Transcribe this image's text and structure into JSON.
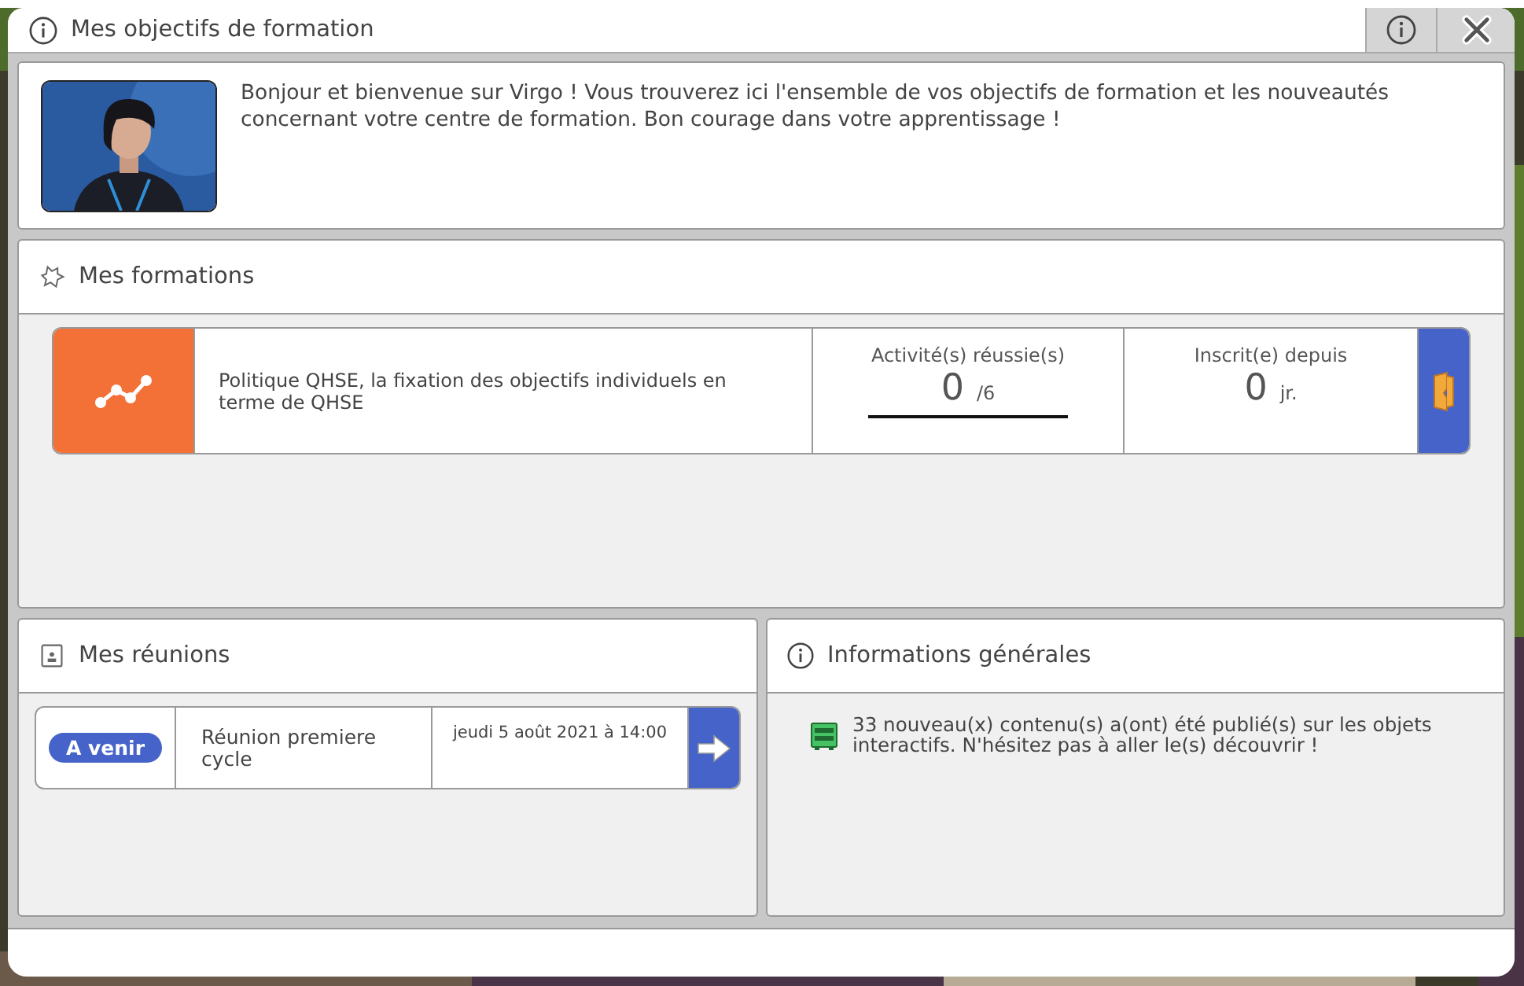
{
  "window": {
    "title": "Mes objectifs de formation"
  },
  "welcome": {
    "kind": "picture",
    "text": "Bonjour et bienvenue sur Virgo ! Vous trouverez ici l'ensemble de vos objectifs de formation et les nouveautés concernant votre centre de formation. Bon courage dans votre apprentissage !"
  },
  "formations": {
    "title": "Mes formations",
    "items": [
      {
        "name": "Politique QHSE, la fixation des objectifs individuels en terme de QHSE",
        "activities_label": "Activité(s) réussie(s)",
        "activities_done": "0",
        "activities_total": "/6",
        "since_label": "Inscrit(e) depuis",
        "since_value": "0",
        "since_unit": "jr."
      }
    ]
  },
  "meetings": {
    "title": "Mes réunions",
    "items": [
      {
        "status": "A venir",
        "title": "Réunion premiere cycle",
        "date": "jeudi 5 août 2021 à 14:00"
      }
    ]
  },
  "info": {
    "title": "Informations générales",
    "items": [
      {
        "text": "33 nouveau(x) contenu(s) a(ont) été publié(s) sur les objets interactifs. N'hésitez pas à aller le(s) découvrir !"
      }
    ]
  }
}
